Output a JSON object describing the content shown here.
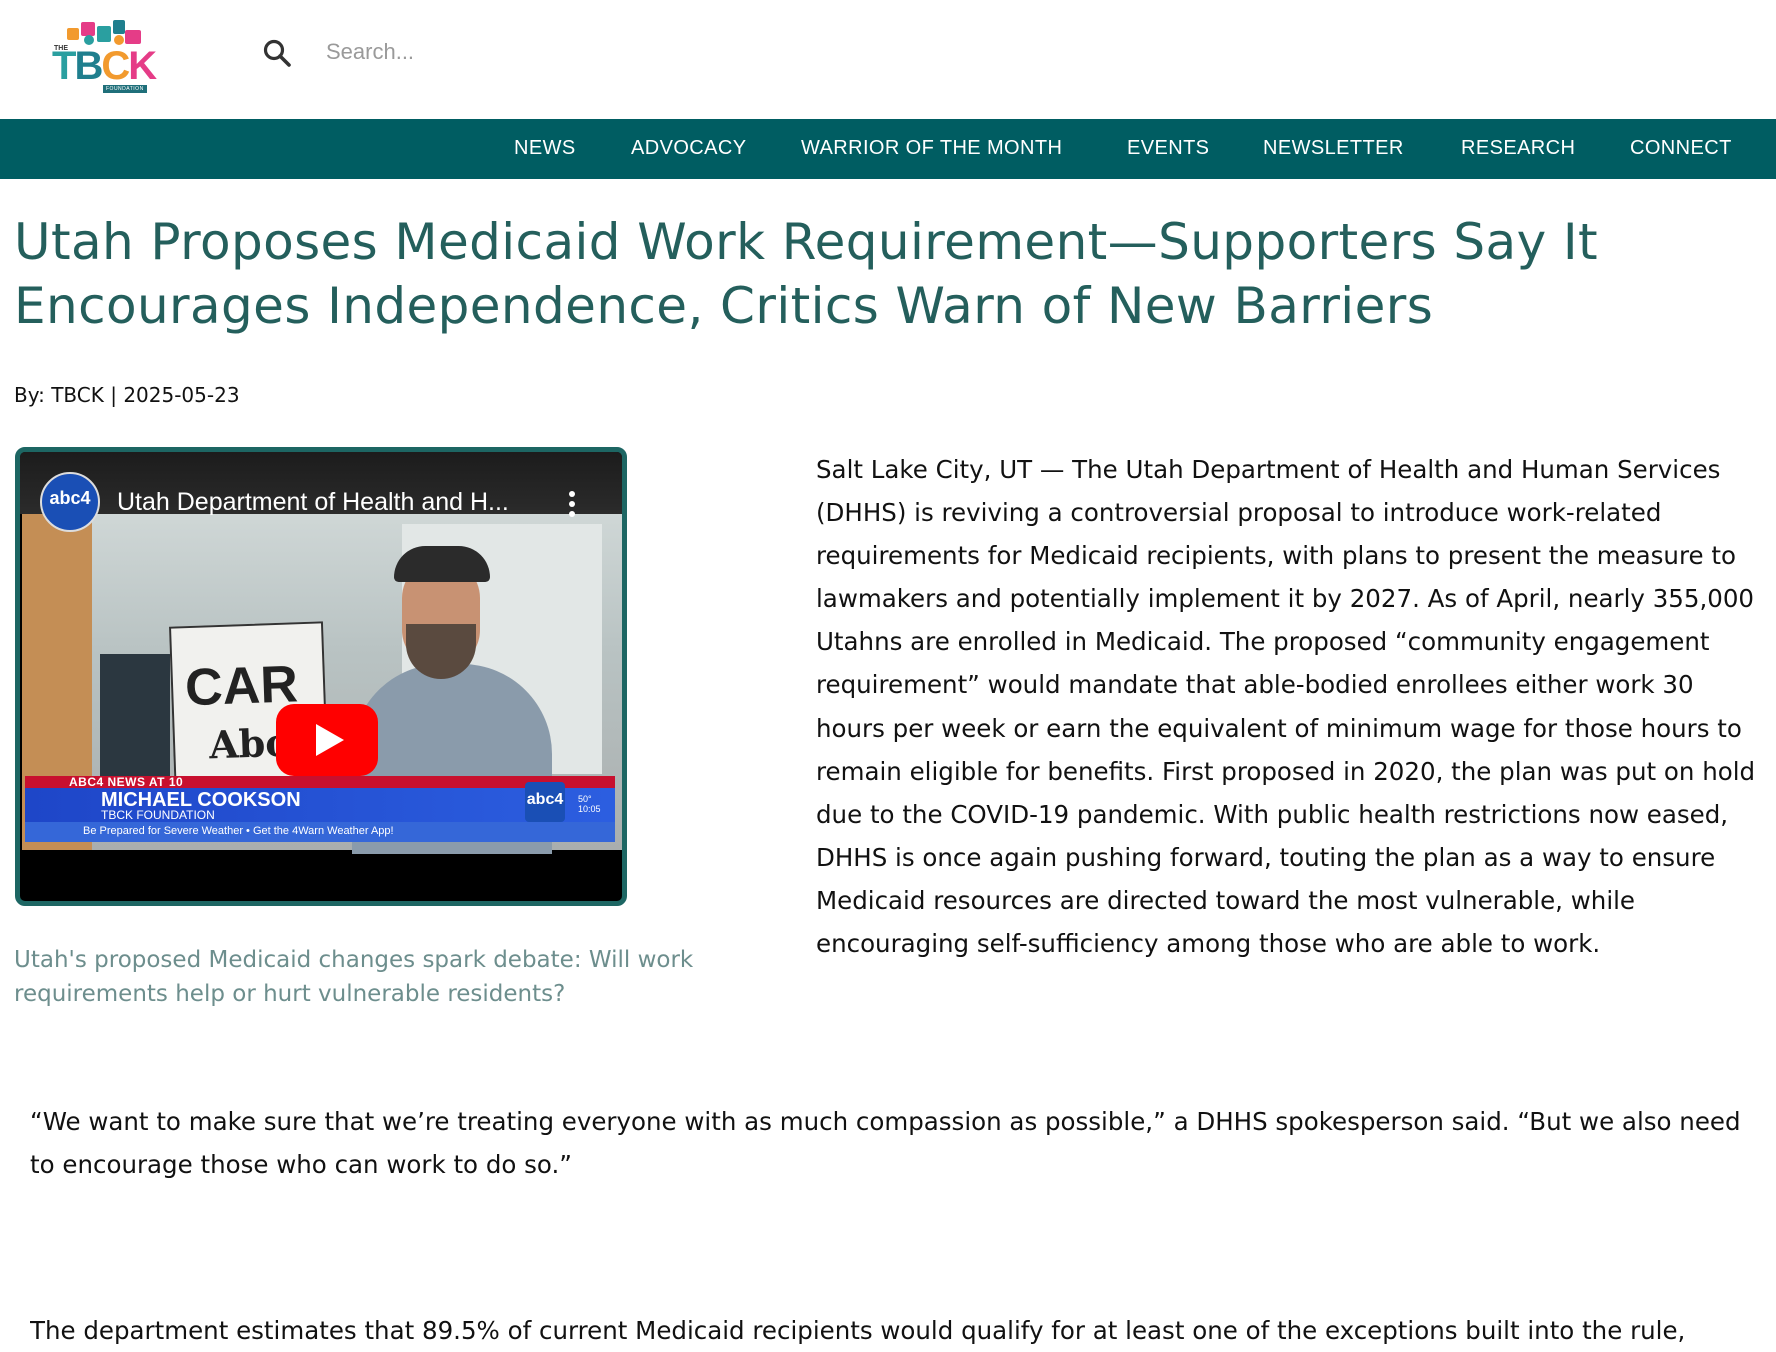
{
  "header": {
    "logo": {
      "small_top": "THE",
      "letters": [
        "T",
        "B",
        "C",
        "K"
      ],
      "sub": "FOUNDATION"
    },
    "search": {
      "icon": "search-icon",
      "placeholder": "Search..."
    }
  },
  "nav": {
    "items": [
      "NEWS",
      "ADVOCACY",
      "WARRIOR OF THE MONTH",
      "EVENTS",
      "NEWSLETTER",
      "RESEARCH",
      "CONNECT"
    ]
  },
  "article": {
    "title": "Utah Proposes Medicaid Work Requirement—Supporters Say It Encourages Independence, Critics Warn of New Barriers",
    "byline": "By: TBCK | 2025-05-23",
    "video": {
      "channel_logo_text": "abc4",
      "title": "Utah Department of Health and H...",
      "sign_line1": "CAR",
      "sign_line2": "About",
      "lower_third_show": "ABC4 NEWS AT 10",
      "lower_third_name": "MICHAEL COOKSON",
      "lower_third_org": "TBCK FOUNDATION",
      "ticker": "Be Prepared for Severe Weather • Get the 4Warn Weather App!",
      "bug": "abc4",
      "temp": "50°",
      "time": "10:05",
      "play_icon": "play-icon",
      "menu_icon": "more-vertical-icon"
    },
    "caption": "Utah's proposed Medicaid changes spark debate: Will work requirements help or hurt vulnerable residents?",
    "paragraph1": "Salt Lake City, UT — The Utah Department of Health and Human Services (DHHS) is reviving a controversial proposal to introduce work-related requirements for Medicaid recipients, with plans to present the measure to lawmakers and potentially implement it by 2027. As of April, nearly 355,000 Utahns are enrolled in Medicaid. The proposed “community engagement requirement” would mandate that able-bodied enrollees either work 30 hours per week or earn the equivalent of minimum wage for those hours to remain eligible for benefits. First proposed in 2020, the plan was put on hold due to the COVID-19 pandemic. With public health restrictions now eased, DHHS is once again pushing forward, touting the plan as a way to ensure Medicaid resources are directed toward the most vulnerable, while encouraging self-sufficiency among those who are able to work.",
    "quote": "“We want to make sure that we’re treating everyone with as much compassion as possible,” a DHHS spokesperson said. “But we also need to encourage those who can work to do so.”",
    "paragraph3": "The department estimates that 89.5% of current Medicaid recipients would qualify for at least one of the exceptions built into the rule,"
  },
  "colors": {
    "nav_bg": "#005d62",
    "title": "#245f5c",
    "caption": "#6d8e8d",
    "video_border": "#1d6663",
    "youtube_red": "#ff0000"
  }
}
